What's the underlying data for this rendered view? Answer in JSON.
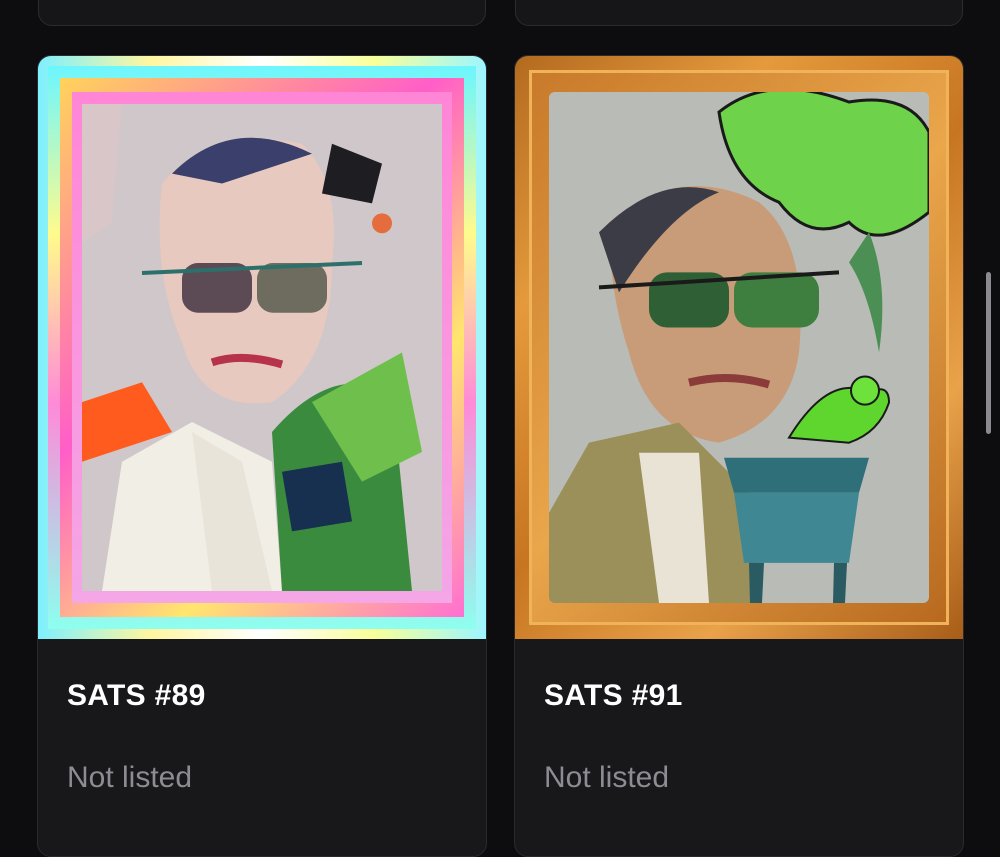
{
  "items": [
    {
      "title": "SATS #89",
      "status": "Not listed",
      "frame": "neon"
    },
    {
      "title": "SATS #91",
      "status": "Not listed",
      "frame": "gold"
    }
  ],
  "colors": {
    "background": "#0d0d0f",
    "card": "#18181b",
    "title": "#ffffff",
    "status": "#8c8c92"
  }
}
